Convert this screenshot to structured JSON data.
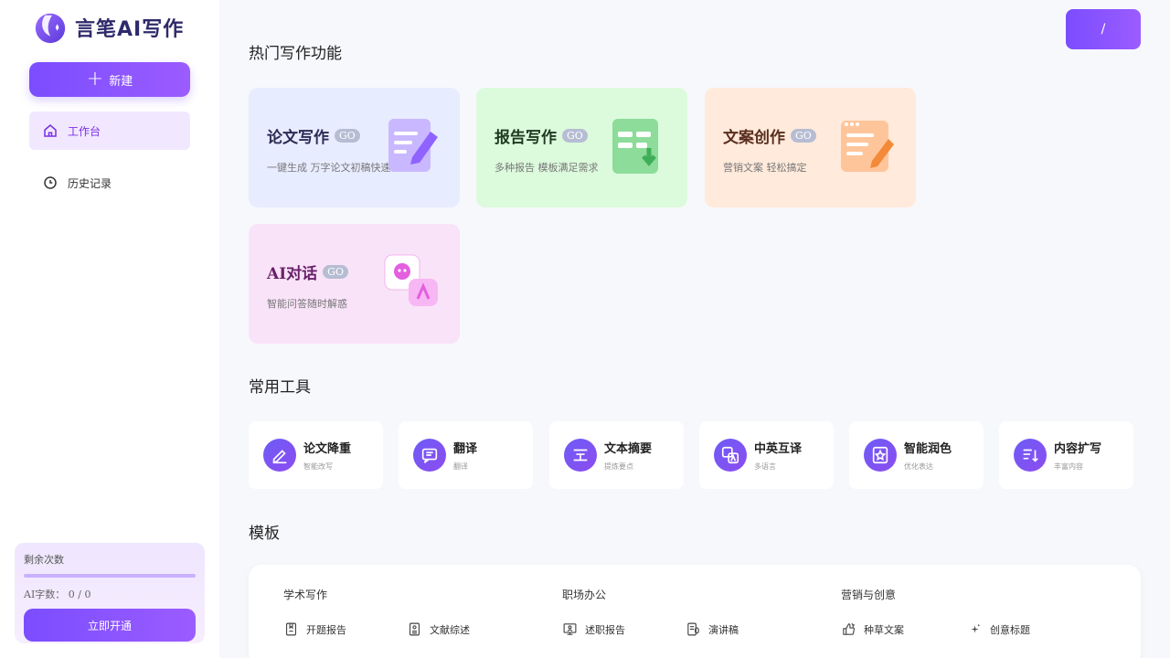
{
  "app": {
    "logo_text": "言笔AI写作"
  },
  "sidebar": {
    "new_button": "新建",
    "items": [
      {
        "label": "工作台"
      },
      {
        "label": "历史记录"
      }
    ],
    "quota": {
      "title": "剩余次数",
      "text": "AI字数： 0 / 0",
      "button": "立即开通"
    }
  },
  "header": {
    "top_button": "/"
  },
  "sections": {
    "featured_title": "热门写作功能",
    "tools_title": "常用工具",
    "templates_title": "模板"
  },
  "featured": [
    {
      "title": "论文写作",
      "go": "GO",
      "desc": "一键生成 万字论文初稿快速",
      "color": "#e8ecff"
    },
    {
      "title": "报告写作",
      "go": "GO",
      "desc": "多种报告 模板满足需求",
      "color": "#dcfadc"
    },
    {
      "title": "文案创作",
      "go": "GO",
      "desc": "营销文案 轻松搞定",
      "color": "#ffeadb"
    },
    {
      "title": "AI对话",
      "go": "GO",
      "desc": "智能问答随时解惑",
      "color": "#f9e3f8"
    }
  ],
  "tools": [
    {
      "title": "论文降重",
      "sub": "智能改写",
      "icon": "edit-icon"
    },
    {
      "title": "翻译",
      "sub": "翻译",
      "icon": "chat-icon"
    },
    {
      "title": "文本摘要",
      "sub": "提炼要点",
      "icon": "summary-icon"
    },
    {
      "title": "中英互译",
      "sub": "多语言",
      "icon": "translate-icon"
    },
    {
      "title": "智能润色",
      "sub": "优化表达",
      "icon": "star-icon"
    },
    {
      "title": "内容扩写",
      "sub": "丰富内容",
      "icon": "expand-icon"
    }
  ],
  "template_columns": [
    {
      "title": "学术写作",
      "items": [
        {
          "label": "开题报告",
          "icon": "bookmark-doc-icon"
        },
        {
          "label": "文献综述",
          "icon": "person-doc-icon"
        }
      ]
    },
    {
      "title": "职场办公",
      "items": [
        {
          "label": "述职报告",
          "icon": "presentation-icon"
        },
        {
          "label": "演讲稿",
          "icon": "mic-doc-icon"
        }
      ]
    },
    {
      "title": "营销与创意",
      "items": [
        {
          "label": "种草文案",
          "icon": "thumbs-up-icon"
        },
        {
          "label": "创意标题",
          "icon": "sparkle-icon"
        }
      ]
    }
  ],
  "colors": {
    "accent": "#7b4dff",
    "active_bg": "#f1e8ff",
    "active_text": "#7b2ee6"
  }
}
